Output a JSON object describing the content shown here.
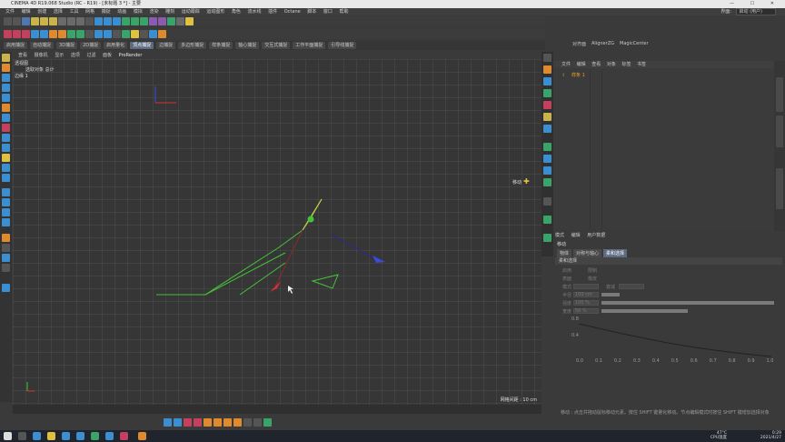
{
  "window": {
    "title": "CINEMA 4D R19.068 Studio (RC - R19) - [未标题 3 *] - 主要"
  },
  "menu": {
    "items": [
      "文件",
      "编辑",
      "创建",
      "选择",
      "工具",
      "网格",
      "捕捉",
      "动画",
      "模拟",
      "渲染",
      "雕刻",
      "运动跟踪",
      "运动图形",
      "角色",
      "流水线",
      "插件",
      "Octane",
      "脚本",
      "窗口",
      "帮助"
    ],
    "layout_label": "界面:",
    "layout_value": "启动 (用户)"
  },
  "modes": [
    {
      "label": "启用捕捉",
      "active": false
    },
    {
      "label": "自动捕捉",
      "active": false
    },
    {
      "label": "3D捕捉",
      "active": false
    },
    {
      "label": "2D捕捉",
      "active": false
    },
    {
      "label": "启用量化",
      "active": false
    },
    {
      "label": "顶点捕捉",
      "active": true
    },
    {
      "label": "边捕捉",
      "active": false
    },
    {
      "label": "多边形捕捉",
      "active": false
    },
    {
      "label": "样条捕捉",
      "active": false
    },
    {
      "label": "轴心捕捉",
      "active": false
    },
    {
      "label": "交互式捕捉",
      "active": false
    },
    {
      "label": "工作平面捕捉",
      "active": false
    },
    {
      "label": "引导线捕捉",
      "active": false
    }
  ],
  "right_tabs": {
    "labels": [
      "对齐面",
      "AlignerZG",
      "MagicCenter"
    ]
  },
  "viewport": {
    "menu": [
      "查看",
      "摄像机",
      "显示",
      "选项",
      "过滤",
      "面板",
      "ProRender"
    ],
    "camera": "透视图",
    "selected": "选取对象 总计",
    "edges": "边缘 1",
    "move_label": "移动",
    "grid_label": "网格间距 : 10 cm"
  },
  "object_manager": {
    "menu": [
      "文件",
      "编辑",
      "查看",
      "对象",
      "标签",
      "书签"
    ],
    "object_name": "样条 1"
  },
  "attribute_manager": {
    "menu": [
      "模式",
      "编辑",
      "用户数据"
    ],
    "title": "移动",
    "tabs": [
      {
        "label": "物体",
        "active": false
      },
      {
        "label": "对称与轴心",
        "active": false
      },
      {
        "label": "柔和选择",
        "active": true
      }
    ],
    "section": "柔和选择",
    "fields": [
      {
        "label": "启用",
        "value": "限制"
      },
      {
        "label": "表面",
        "value": "橡皮"
      },
      {
        "label": "模式",
        "value": "衰减"
      },
      {
        "label": "半径",
        "value": "100 cm"
      },
      {
        "label": "强度",
        "value": "100 %"
      },
      {
        "label": "宽度",
        "value": "50 %"
      }
    ],
    "curve_y": [
      "0.8",
      "0.4"
    ],
    "curve_x": [
      "0.0",
      "0.1",
      "0.2",
      "0.3",
      "0.4",
      "0.5",
      "0.6",
      "0.7",
      "0.8",
      "0.9",
      "1.0"
    ]
  },
  "status": {
    "text": "移动 : 点击并拖动鼠标移动元素。按住 SHIFT 键量化移动。节点编辑模式时按住 SHIFT 键增加选择对象"
  },
  "taskbar": {
    "temp": "47°C",
    "cpu": "CPU温度",
    "time": "0:29",
    "date": "2021/4/27"
  },
  "colors": {
    "accent": "#5c6b80",
    "spline_green": "#44c23a",
    "axis_red": "#d93030",
    "axis_blue": "#3a4ad9",
    "spline_yellow": "#e6d24a"
  }
}
